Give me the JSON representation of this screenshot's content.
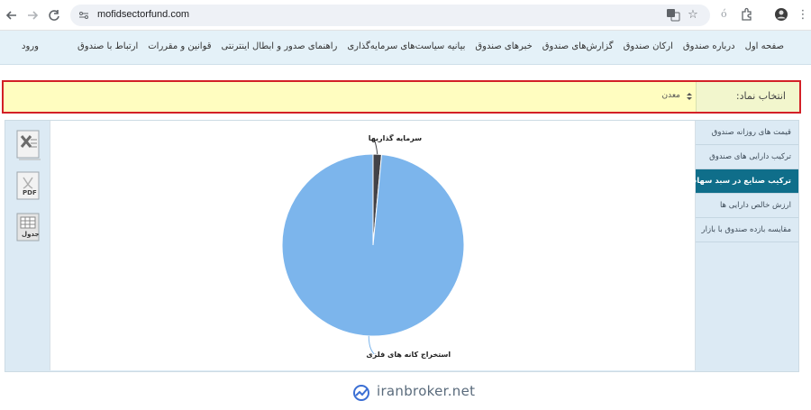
{
  "browser": {
    "url": "mofidsectorfund.com",
    "back_icon": "arrow-left-icon",
    "forward_icon": "arrow-right-icon",
    "reload_icon": "reload-icon"
  },
  "menu": {
    "items": [
      "صفحه اول",
      "درباره صندوق",
      "ارکان صندوق",
      "گزارش‌های صندوق",
      "خبرهای صندوق",
      "بیانیه سیاست‌های سرمایه‌گذاری",
      "راهنمای صدور و ابطال اینترنتی",
      "قوانین و مقررات",
      "ارتباط با صندوق"
    ],
    "login": "ورود"
  },
  "symbol": {
    "label": "انتخاب نماد:",
    "selected": "معدن"
  },
  "side_menu": {
    "items": [
      {
        "label": "قیمت های روزانه صندوق",
        "active": false
      },
      {
        "label": "ترکیب دارایی های صندوق",
        "active": false
      },
      {
        "label": "ترکیب صنایع در سبد سهام",
        "active": true
      },
      {
        "label": "ارزش خالص دارایی ها",
        "active": false
      },
      {
        "label": "مقایسه بازده صندوق با بازار",
        "active": false
      }
    ]
  },
  "tools": {
    "excel_icon": "excel-icon",
    "pdf_label": "PDF",
    "table_label": "جدول"
  },
  "chart_data": {
    "type": "pie",
    "slices": [
      {
        "label": "استخراج کانه های فلزی",
        "value": 98.5,
        "color": "#7cb5ec"
      },
      {
        "label": "سرمایه گذاریها",
        "value": 1.5,
        "color": "#434348"
      }
    ]
  },
  "footer": {
    "brand": "iranbroker.net"
  },
  "colors": {
    "accent": "#0f6e8a",
    "highlight_border": "#d32027",
    "menu_bg": "#e4f1f8",
    "symbol_bg": "#fffdc0"
  }
}
